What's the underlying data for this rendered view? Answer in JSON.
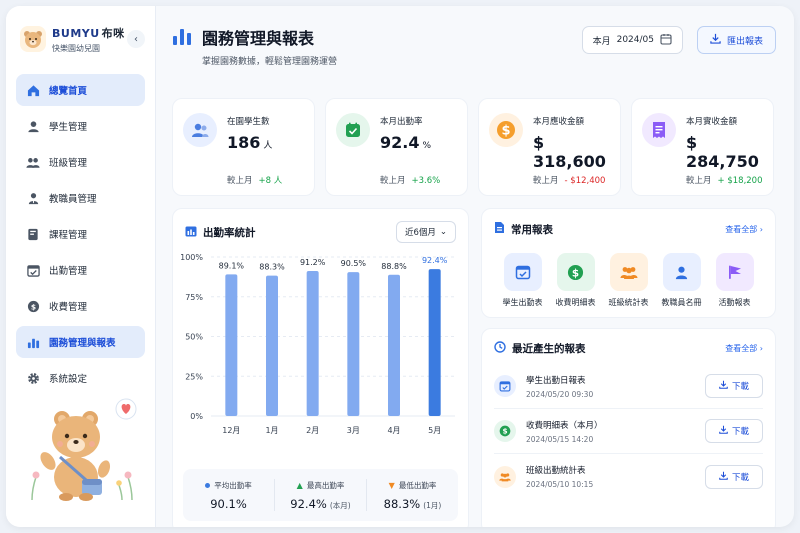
{
  "brand": {
    "name": "BUMYU",
    "name_cn": "布咪",
    "subtitle": "快樂園幼兒園"
  },
  "sidebar": {
    "items": [
      {
        "label": "總覽首頁",
        "icon": "home-icon",
        "active": true
      },
      {
        "label": "學生管理",
        "icon": "student-icon",
        "active": false
      },
      {
        "label": "班級管理",
        "icon": "class-icon",
        "active": false
      },
      {
        "label": "教職員管理",
        "icon": "staff-icon",
        "active": false
      },
      {
        "label": "課程管理",
        "icon": "course-icon",
        "active": false
      },
      {
        "label": "出勤管理",
        "icon": "attendance-icon",
        "active": false
      },
      {
        "label": "收費管理",
        "icon": "fee-icon",
        "active": false
      },
      {
        "label": "園務管理與報表",
        "icon": "chart-icon",
        "active": true
      },
      {
        "label": "系統設定",
        "icon": "gear-icon",
        "active": false
      }
    ]
  },
  "header": {
    "title": "園務管理與報表",
    "subtitle": "掌握園務數據，輕鬆管理園務運營",
    "month_label": "本月",
    "month_value": "2024/05",
    "export_label": "匯出報表"
  },
  "stats": [
    {
      "label": "在園學生數",
      "value": "186",
      "unit": "人",
      "compare_label": "較上月",
      "delta": "+8 人",
      "trend": "up",
      "color": "#e8efff",
      "icon": "users-icon"
    },
    {
      "label": "本月出勤率",
      "value": "92.4",
      "unit": "%",
      "compare_label": "較上月",
      "delta": "+3.6%",
      "trend": "up",
      "color": "#e5f6ec",
      "icon": "check-calendar-icon"
    },
    {
      "label": "本月應收金額",
      "value": "$ 318,600",
      "unit": "",
      "compare_label": "較上月",
      "delta": "- $12,400",
      "trend": "down",
      "color": "#fff1e0",
      "icon": "dollar-icon"
    },
    {
      "label": "本月實收金額",
      "value": "$ 284,750",
      "unit": "",
      "compare_label": "較上月",
      "delta": "+ $18,200",
      "trend": "up",
      "color": "#f1e9ff",
      "icon": "receipt-icon"
    }
  ],
  "attendance": {
    "title": "出勤率統計",
    "range": "近6個月",
    "summary": [
      {
        "label": "平均出勤率",
        "value": "90.1%",
        "note": "",
        "marker": "dot"
      },
      {
        "label": "最高出勤率",
        "value": "92.4%",
        "note": "(本月)",
        "marker": "up-arrow"
      },
      {
        "label": "最低出勤率",
        "value": "88.3%",
        "note": "(1月)",
        "marker": "down-arrow"
      }
    ]
  },
  "chart_data": {
    "type": "bar",
    "categories": [
      "12月",
      "1月",
      "2月",
      "3月",
      "4月",
      "5月"
    ],
    "values": [
      89.1,
      88.3,
      91.2,
      90.5,
      88.8,
      92.4
    ],
    "value_labels": [
      "89.1%",
      "88.3%",
      "91.2%",
      "90.5%",
      "88.8%",
      "92.4%"
    ],
    "ylim": [
      0,
      100
    ],
    "yticks": [
      "0%",
      "25%",
      "50%",
      "75%",
      "100%"
    ],
    "grid": true,
    "highlight_index": 5,
    "bar_color": "#82aaf0",
    "highlight_color": "#3b7be0"
  },
  "reports": {
    "title": "常用報表",
    "view_all": "查看全部",
    "items": [
      {
        "label": "學生出勤表",
        "icon": "calendar-check-icon",
        "bg": "#e8efff",
        "fg": "#2f6fe0"
      },
      {
        "label": "收費明細表",
        "icon": "dollar-icon",
        "bg": "#e5f6ec",
        "fg": "#22a052"
      },
      {
        "label": "班級統計表",
        "icon": "group-icon",
        "bg": "#fff1e0",
        "fg": "#f08a24"
      },
      {
        "label": "教職員名冊",
        "icon": "person-icon",
        "bg": "#e8efff",
        "fg": "#2f6fe0"
      },
      {
        "label": "活動報表",
        "icon": "flag-icon",
        "bg": "#f1e9ff",
        "fg": "#8b5cf6"
      }
    ]
  },
  "recent": {
    "title": "最近產生的報表",
    "view_all": "查看全部",
    "download_label": "下載",
    "items": [
      {
        "name": "學生出勤日報表",
        "time": "2024/05/20 09:30",
        "icon": "calendar-check-icon",
        "bg": "#e8efff",
        "fg": "#2f6fe0"
      },
      {
        "name": "收費明細表（本月）",
        "time": "2024/05/15 14:20",
        "icon": "dollar-icon",
        "bg": "#e5f6ec",
        "fg": "#22a052"
      },
      {
        "name": "班級出勤統計表",
        "time": "2024/05/10 10:15",
        "icon": "group-icon",
        "bg": "#fff1e0",
        "fg": "#f08a24"
      }
    ]
  }
}
